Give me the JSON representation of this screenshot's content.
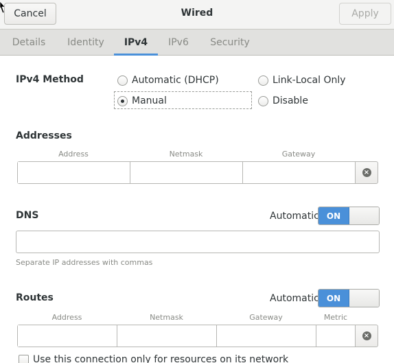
{
  "header": {
    "cancel_label": "Cancel",
    "title": "Wired",
    "apply_label": "Apply"
  },
  "tabs": [
    {
      "label": "Details"
    },
    {
      "label": "Identity"
    },
    {
      "label": "IPv4",
      "active": true
    },
    {
      "label": "IPv6"
    },
    {
      "label": "Security"
    }
  ],
  "ipv4_method": {
    "label": "IPv4 Method",
    "options": [
      {
        "label": "Automatic (DHCP)",
        "checked": false
      },
      {
        "label": "Link-Local Only",
        "checked": false
      },
      {
        "label": "Manual",
        "checked": true
      },
      {
        "label": "Disable",
        "checked": false
      }
    ]
  },
  "addresses": {
    "title": "Addresses",
    "columns": [
      "Address",
      "Netmask",
      "Gateway"
    ],
    "row": {
      "address": "",
      "netmask": "",
      "gateway": ""
    }
  },
  "dns": {
    "title": "DNS",
    "automatic_label": "Automatic",
    "switch_label": "ON",
    "switch_state": true,
    "value": "",
    "hint": "Separate IP addresses with commas"
  },
  "routes": {
    "title": "Routes",
    "automatic_label": "Automatic",
    "switch_label": "ON",
    "switch_state": true,
    "columns": [
      "Address",
      "Netmask",
      "Gateway",
      "Metric"
    ],
    "row": {
      "address": "",
      "netmask": "",
      "gateway": "",
      "metric": ""
    }
  },
  "restrict_checkbox": {
    "label": "Use this connection only for resources on its network",
    "checked": false
  },
  "colors": {
    "accent": "#4a90d9",
    "text": "#2e3436",
    "muted": "#888a85"
  }
}
